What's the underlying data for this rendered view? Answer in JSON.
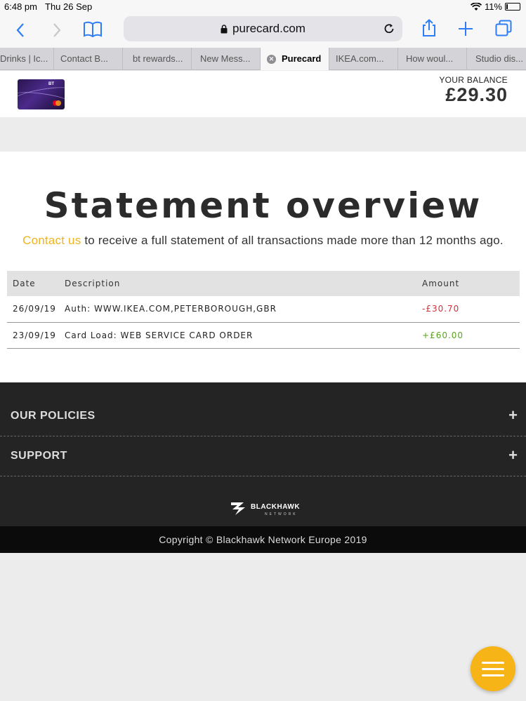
{
  "status_bar": {
    "time": "6:48 pm",
    "date": "Thu 26 Sep",
    "battery": "11%"
  },
  "toolbar": {
    "url": "purecard.com"
  },
  "tabs": [
    {
      "label": "Drinks | Ic..."
    },
    {
      "label": "Contact B..."
    },
    {
      "label": "bt rewards..."
    },
    {
      "label": "New Mess..."
    },
    {
      "label": "Purecard"
    },
    {
      "label": "IKEA.com..."
    },
    {
      "label": "How woul..."
    },
    {
      "label": "Studio dis..."
    }
  ],
  "header": {
    "balance_label": "YOUR BALANCE",
    "balance_value": "£29.30",
    "card_brand": "BT"
  },
  "main": {
    "title": "Statement overview",
    "intro_link": "Contact us",
    "intro_text": " to receive a full statement of all transactions made more than 12 months ago."
  },
  "table": {
    "headers": {
      "date": "Date",
      "description": "Description",
      "amount": "Amount"
    },
    "rows": [
      {
        "date": "26/09/19",
        "description": "Auth: WWW.IKEA.COM,PETERBOROUGH,GBR",
        "amount": "-£30.70"
      },
      {
        "date": "23/09/19",
        "description": "Card Load: WEB SERVICE CARD ORDER",
        "amount": "+£60.00"
      }
    ]
  },
  "footer": {
    "accordions": [
      {
        "label": "OUR POLICIES"
      },
      {
        "label": "SUPPORT"
      }
    ],
    "logo_text": "BLACKHAWK",
    "logo_sub": "NETWORK",
    "copyright": "Copyright © Blackhawk Network Europe 2019"
  },
  "colors": {
    "accent": "#f0b321",
    "negative": "#d0313b",
    "positive": "#5aa31f",
    "footer_bg": "#242424",
    "fab": "#f6b416"
  },
  "icons": [
    "back-icon",
    "forward-icon",
    "bookmarks-icon",
    "lock-icon",
    "reload-icon",
    "share-icon",
    "new-tab-icon",
    "tabs-icon",
    "wifi-icon",
    "battery-icon",
    "close-tab-icon",
    "plus-icon",
    "menu-icon"
  ]
}
